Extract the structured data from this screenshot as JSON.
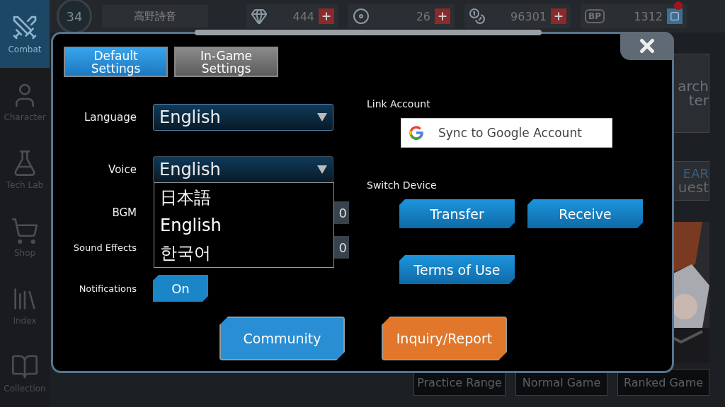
{
  "sidebar": {
    "items": [
      {
        "label": "Combat",
        "selected": true
      },
      {
        "label": "Character",
        "selected": false
      },
      {
        "label": "Tech Lab",
        "selected": false
      },
      {
        "label": "Shop",
        "selected": false
      },
      {
        "label": "Index",
        "selected": false
      },
      {
        "label": "Collection",
        "selected": false
      }
    ]
  },
  "top_bar": {
    "level": "34",
    "player_name": "高野詩音",
    "currencies": [
      {
        "amount": "444",
        "alert": false
      },
      {
        "amount": "26",
        "alert": false
      },
      {
        "amount": "96301",
        "alert": false
      },
      {
        "amount": "1312",
        "emblem": "BP",
        "alert": true
      }
    ]
  },
  "background": {
    "research_tile": [
      "arch",
      "ter"
    ],
    "event_tile": [
      "EAR",
      "uest"
    ],
    "mode_buttons": [
      "Practice Range",
      "Normal Game",
      "Ranked Game"
    ]
  },
  "dialog": {
    "tabs": [
      {
        "label": "Default Settings",
        "selected": true
      },
      {
        "label": "In-Game Settings",
        "selected": false
      }
    ],
    "settings": [
      {
        "kind": "dropdown",
        "label": "Language",
        "value": "English",
        "expanded": false
      },
      {
        "kind": "dropdown",
        "label": "Voice",
        "value": "English",
        "expanded": true,
        "options": [
          "日本語",
          "English",
          "한국어"
        ]
      },
      {
        "kind": "volume",
        "label": "BGM",
        "value": "0"
      },
      {
        "kind": "volume",
        "label": "Sound Effects",
        "value": "0"
      },
      {
        "kind": "toggle",
        "label": "Notifications",
        "value": "On",
        "on": true
      }
    ],
    "link_account": {
      "label": "Link Account",
      "button": "Sync to Google Account"
    },
    "switch_device": {
      "label": "Switch Device",
      "buttons": [
        "Transfer",
        "Receive"
      ]
    },
    "terms_button": "Terms of Use",
    "footer_buttons": [
      {
        "label": "Community",
        "color": "#2a8ed4"
      },
      {
        "label": "Inquiry/Report",
        "color": "#e0772a"
      }
    ]
  }
}
